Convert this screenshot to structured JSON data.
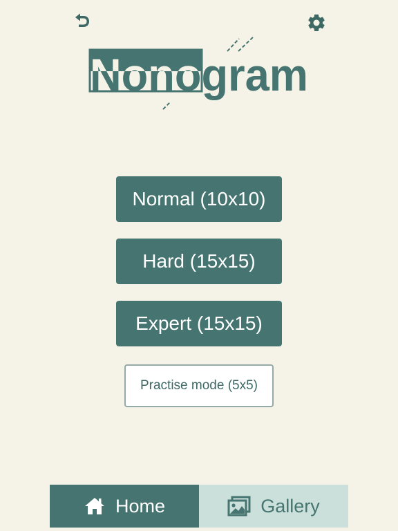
{
  "app": {
    "title_text": "Nonogram"
  },
  "header": {
    "back_icon": "back-arrow-icon",
    "settings_icon": "gear-icon"
  },
  "menu": {
    "buttons": [
      {
        "label": "Normal (10x10)"
      },
      {
        "label": "Hard (15x15)"
      },
      {
        "label": "Expert (15x15)"
      }
    ],
    "practise_label": "Practise mode (5x5)"
  },
  "nav": {
    "tabs": [
      {
        "label": "Home",
        "icon": "home-icon",
        "active": true
      },
      {
        "label": "Gallery",
        "icon": "gallery-icon",
        "active": false
      }
    ]
  },
  "colors": {
    "background": "#f5f3e8",
    "accent": "#467470",
    "accent_light": "#cbe0da",
    "text_light": "#ffffff"
  }
}
